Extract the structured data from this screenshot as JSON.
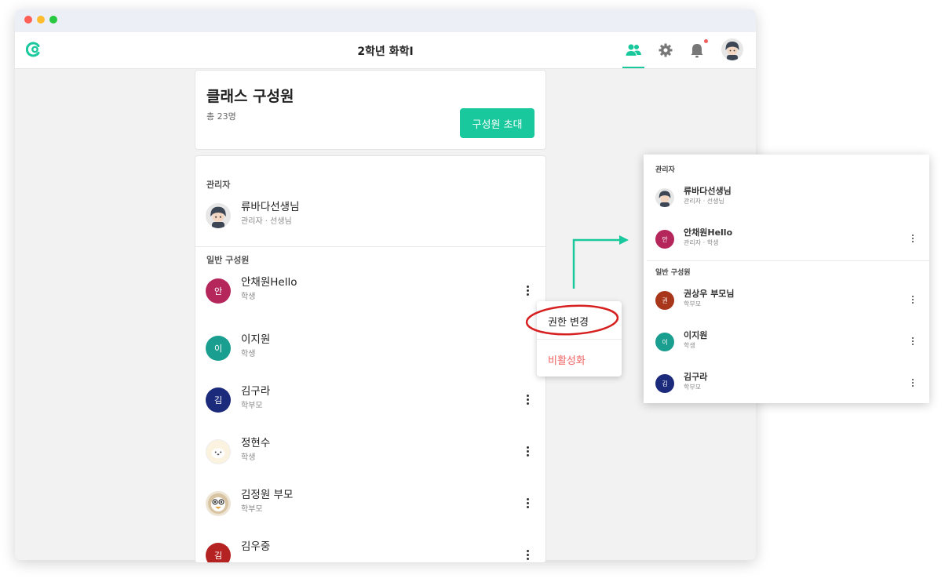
{
  "app": {
    "title": "2학년 화학I"
  },
  "colors": {
    "accent": "#19c89c",
    "danger": "#f06060"
  },
  "nav": {
    "icons": [
      "members-icon",
      "gear-icon",
      "bell-icon",
      "profile-avatar"
    ]
  },
  "header_card": {
    "title": "클래스 구성원",
    "count": "총 23명",
    "invite_label": "구성원 초대"
  },
  "list": {
    "admin_label": "관리자",
    "admin": {
      "name": "류바다선생님",
      "role": "관리자 · 선생님"
    },
    "general_label": "일반 구성원",
    "members": [
      {
        "name": "안채원Hello",
        "role": "학생",
        "initial": "안",
        "color": "#b5265a"
      },
      {
        "name": "이지원",
        "role": "학생",
        "initial": "이",
        "color": "#1a9e8f"
      },
      {
        "name": "김구라",
        "role": "학부모",
        "initial": "김",
        "color": "#1b2a7a"
      },
      {
        "name": "정현수",
        "role": "학생",
        "initial": "",
        "color": "#fbf3df"
      },
      {
        "name": "김정원 부모",
        "role": "학부모",
        "initial": "",
        "color": "#ede4d3"
      },
      {
        "name": "김우중",
        "role": "",
        "initial": "김",
        "color": "#b52222"
      }
    ]
  },
  "context_menu": {
    "change_role": "권한 변경",
    "deactivate": "비활성화"
  },
  "zoom_panel": {
    "admin_label": "관리자",
    "general_label": "일반 구성원",
    "admins": [
      {
        "name": "류바다선생님",
        "role": "관리자 · 선생님",
        "initial": "",
        "color": "#e7e7e7"
      },
      {
        "name": "안채원Hello",
        "role": "관리자 · 학생",
        "initial": "안",
        "color": "#b5265a"
      }
    ],
    "members": [
      {
        "name": "권상우 부모님",
        "role": "학부모",
        "initial": "권",
        "color": "#a8361a"
      },
      {
        "name": "이지원",
        "role": "학생",
        "initial": "이",
        "color": "#1a9e8f"
      },
      {
        "name": "김구라",
        "role": "학부모",
        "initial": "김",
        "color": "#1b2a7a"
      }
    ]
  }
}
